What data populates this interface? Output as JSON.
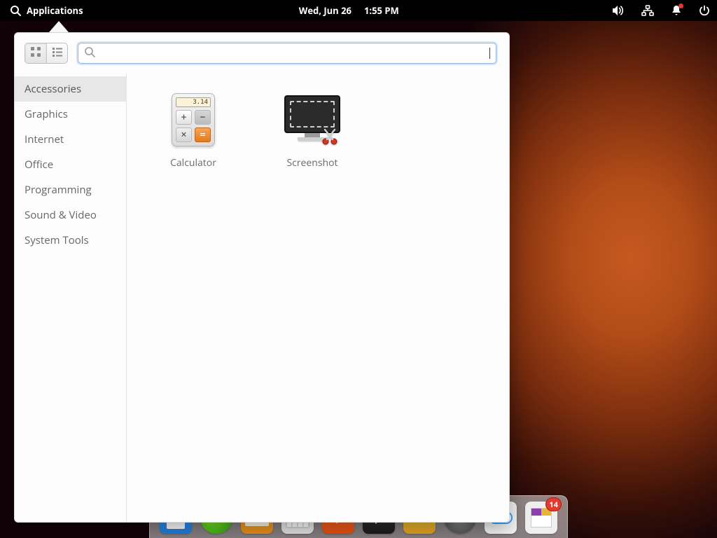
{
  "panel": {
    "applications_label": "Applications",
    "date": "Wed, Jun 26",
    "time": "1:55 PM"
  },
  "menu": {
    "search_value": "",
    "categories": [
      "Accessories",
      "Graphics",
      "Internet",
      "Office",
      "Programming",
      "Sound & Video",
      "System Tools"
    ],
    "selected_category_index": 0,
    "apps": [
      {
        "label": "Calculator",
        "display_value": "3.14"
      },
      {
        "label": "Screenshot"
      }
    ]
  },
  "dock": {
    "store_badge": "14"
  }
}
